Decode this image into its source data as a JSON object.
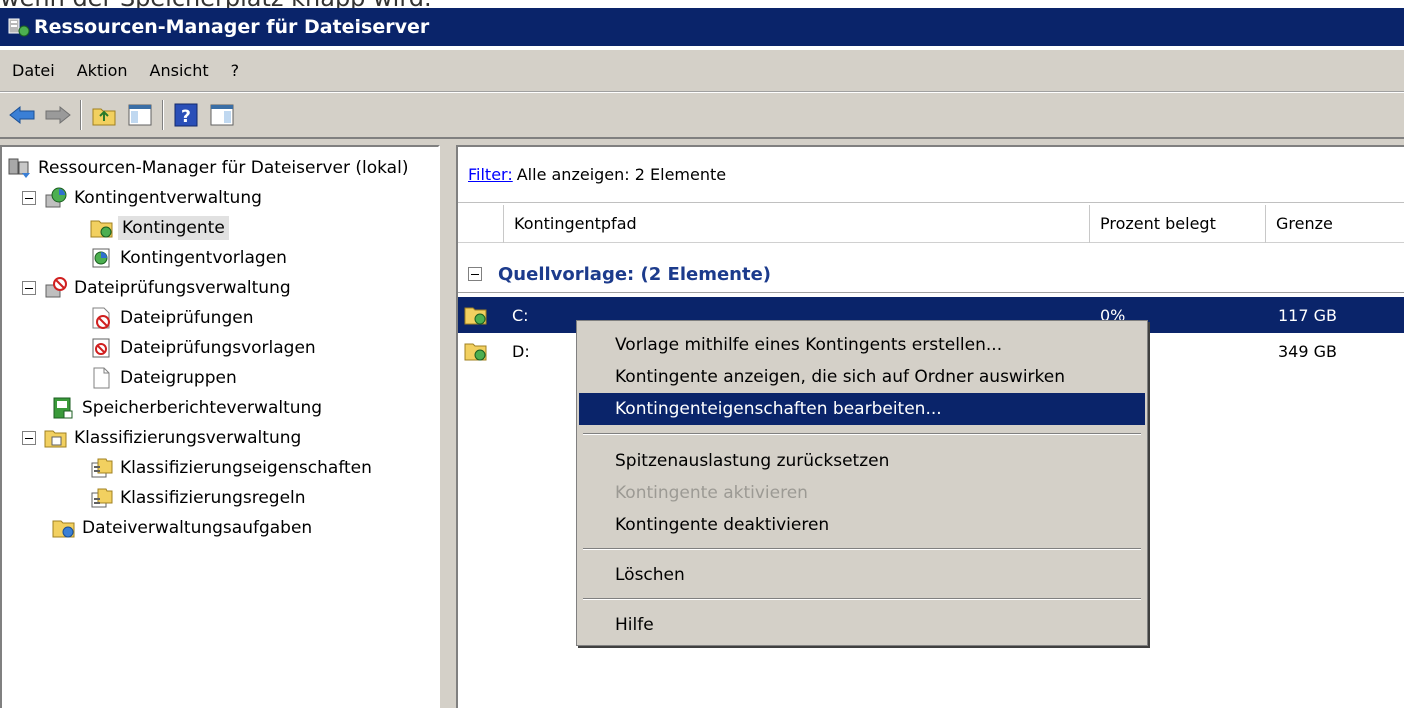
{
  "above_text": "wenn der Speicherplatz knapp wird.",
  "window": {
    "title": "Ressourcen-Manager für Dateiserver"
  },
  "menu": [
    "Datei",
    "Aktion",
    "Ansicht",
    "?"
  ],
  "tree": [
    {
      "label": "Ressourcen-Manager für Dateiserver (lokal)",
      "icon": "server-icon"
    },
    {
      "label": "Kontingentverwaltung",
      "icon": "quota-management-icon",
      "expanded": true
    },
    {
      "label": "Kontingente",
      "icon": "quota-folder-icon",
      "selected": true
    },
    {
      "label": "Kontingentvorlagen",
      "icon": "quota-template-icon"
    },
    {
      "label": "Dateiprüfungsverwaltung",
      "icon": "file-screen-management-icon",
      "expanded": true
    },
    {
      "label": "Dateiprüfungen",
      "icon": "file-screen-icon"
    },
    {
      "label": "Dateiprüfungsvorlagen",
      "icon": "file-screen-template-icon"
    },
    {
      "label": "Dateigruppen",
      "icon": "file-group-icon"
    },
    {
      "label": "Speicherberichteverwaltung",
      "icon": "storage-report-icon"
    },
    {
      "label": "Klassifizierungsverwaltung",
      "icon": "classification-icon",
      "expanded": true
    },
    {
      "label": "Klassifizierungseigenschaften",
      "icon": "classification-property-icon"
    },
    {
      "label": "Klassifizierungsregeln",
      "icon": "classification-rule-icon"
    },
    {
      "label": "Dateiverwaltungsaufgaben",
      "icon": "file-management-task-icon"
    }
  ],
  "filter": {
    "link": "Filter:",
    "text": "Alle anzeigen: 2 Elemente"
  },
  "columns": [
    "Kontingentpfad",
    "Prozent belegt",
    "Grenze"
  ],
  "group": {
    "label": "Quellvorlage:  (2 Elemente)"
  },
  "rows": [
    {
      "path": "C:",
      "percent": "0%",
      "limit": "117 GB",
      "selected": true
    },
    {
      "path": "D:",
      "percent": "",
      "limit": "349 GB",
      "selected": false
    }
  ],
  "context_menu": {
    "items": [
      {
        "label": "Vorlage mithilfe eines Kontingents erstellen...",
        "state": "normal"
      },
      {
        "label": "Kontingente anzeigen, die sich auf Ordner auswirken",
        "state": "normal"
      },
      {
        "label": "Kontingenteigenschaften bearbeiten...",
        "state": "highlighted"
      },
      {
        "label": "Spitzenauslastung zurücksetzen",
        "state": "normal"
      },
      {
        "label": "Kontingente aktivieren",
        "state": "disabled"
      },
      {
        "label": "Kontingente deaktivieren",
        "state": "normal"
      },
      {
        "label": "Löschen",
        "state": "normal"
      },
      {
        "label": "Hilfe",
        "state": "normal"
      }
    ]
  },
  "colors": {
    "titlebar": "#0a246a",
    "selection": "#0a246a",
    "chrome": "#d4d0c8",
    "link": "#0000ff",
    "group_text": "#1c3b8c"
  }
}
